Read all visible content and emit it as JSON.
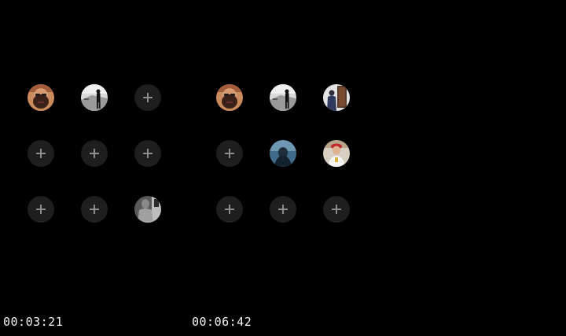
{
  "colors": {
    "background": "#000000",
    "empty_slot": "#1e1e1e",
    "plus_glyph": "#8c8c8c",
    "timecode_text": "#f2f2f2"
  },
  "panels": [
    {
      "timecode": "00:03:21",
      "slots": [
        {
          "state": "filled",
          "icon": "avatar-bearded-man"
        },
        {
          "state": "filled",
          "icon": "avatar-silhouette-beach"
        },
        {
          "state": "empty",
          "icon": "plus-icon"
        },
        {
          "state": "empty",
          "icon": "plus-icon"
        },
        {
          "state": "empty",
          "icon": "plus-icon"
        },
        {
          "state": "empty",
          "icon": "plus-icon"
        },
        {
          "state": "empty",
          "icon": "plus-icon"
        },
        {
          "state": "empty",
          "icon": "plus-icon"
        },
        {
          "state": "filled",
          "icon": "avatar-monochrome-person"
        }
      ]
    },
    {
      "timecode": "00:06:42",
      "slots": [
        {
          "state": "filled",
          "icon": "avatar-bearded-man"
        },
        {
          "state": "filled",
          "icon": "avatar-silhouette-beach"
        },
        {
          "state": "filled",
          "icon": "avatar-person-doorway"
        },
        {
          "state": "empty",
          "icon": "plus-icon"
        },
        {
          "state": "filled",
          "icon": "avatar-blue-figure"
        },
        {
          "state": "filled",
          "icon": "avatar-person-red-cap"
        },
        {
          "state": "empty",
          "icon": "plus-icon"
        },
        {
          "state": "empty",
          "icon": "plus-icon"
        },
        {
          "state": "empty",
          "icon": "plus-icon"
        }
      ]
    }
  ]
}
